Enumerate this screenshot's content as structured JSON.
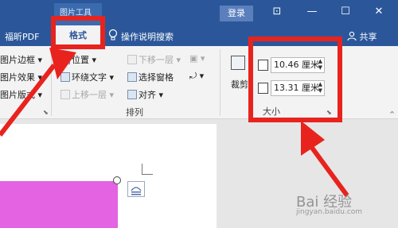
{
  "window": {
    "context_tab_group": "图片工具",
    "login_button": "登录",
    "controls": [
      "⊡",
      "—",
      "☐",
      "✕"
    ]
  },
  "tabs": {
    "foxit_pdf": "福昕PDF",
    "format": "格式",
    "tell_me": "操作说明搜索",
    "share": "共享"
  },
  "ribbon": {
    "picture_styles": {
      "border": "图片边框",
      "effects": "图片效果",
      "layout": "图片版式"
    },
    "arrange": {
      "position": "位置",
      "wrap_text": "环绕文字",
      "bring_forward": "上移一层",
      "send_backward": "下移一层",
      "selection_pane": "选择窗格",
      "align": "对齐",
      "group_label": "排列"
    },
    "size": {
      "crop": "裁剪",
      "height": "10.46 厘米",
      "width": "13.31 厘米",
      "group_label": "大小"
    }
  },
  "watermark": {
    "text": "Bai 经验",
    "sub": "jingyan.baidu.com"
  },
  "colors": {
    "title_bar": "#2b579a",
    "highlight": "#e8231e",
    "shape_fill": "#e363e3"
  }
}
